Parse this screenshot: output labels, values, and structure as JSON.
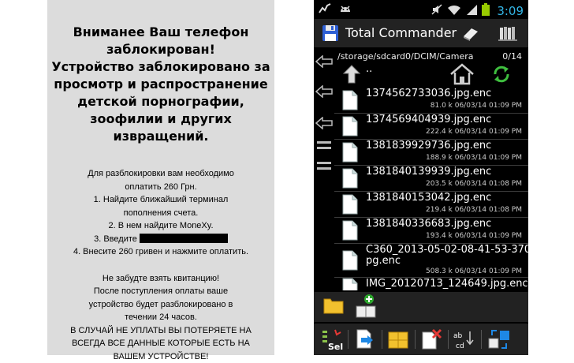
{
  "ransom": {
    "headline": [
      "Вниманее Ваш телефон",
      "заблокирован!",
      "Устройство заблокировано за",
      "просмотр и распространение",
      "детской порнографии,",
      "зоофилии и других",
      "извращений."
    ],
    "instructions": [
      "Для разблокировки вам необходимо",
      "оплатить 260 Грн.",
      "1. Найдите ближайший терминал",
      "пополнения счета.",
      "2. В нем найдите MoneXy."
    ],
    "step3_prefix": "3. Введите",
    "step4": "4. Внесите 260 гривен и нажмите оплатить.",
    "warning": [
      "Не забудте взять квитанцию!",
      "После поступления оплаты ваше",
      "устройство будет разблокировано в",
      "течении 24 часов.",
      "В СЛУЧАЙ НЕ УПЛАТЫ ВЫ ПОТЕРЯЕТЕ НА",
      "ВСЕГДА ВСЕ ДАННЫЕ КОТОРЫЕ ЕСТЬ НА",
      "ВАШЕМ УСТРОЙСТВЕ!"
    ]
  },
  "status_bar": {
    "time": "3:09"
  },
  "app": {
    "title": "Total Commander"
  },
  "browser": {
    "path": "/storage/sdcard0/DCIM/Camera",
    "count": "0/14",
    "parent": "..",
    "files": [
      {
        "name": "1374562733036.jpg.enc",
        "meta": "81.0 k  06/03/14  01:09 PM"
      },
      {
        "name": "1374569404939.jpg.enc",
        "meta": "222.4 k  06/03/14  01:09 PM"
      },
      {
        "name": "1381839929736.jpg.enc",
        "meta": "188.9 k  06/03/14  01:09 PM"
      },
      {
        "name": "1381840139939.jpg.enc",
        "meta": "203.5 k  06/03/14  01:08 PM"
      },
      {
        "name": "1381840153042.jpg.enc",
        "meta": "219.4 k  06/03/14  01:08 PM"
      },
      {
        "name": "1381840336683.jpg.enc",
        "meta": "193.4 k  06/03/14  01:09 PM"
      },
      {
        "name": "C360_2013-05-02-08-41-53-370.j",
        "name2": "pg.enc",
        "meta": "508.3 k  06/03/14  01:09 PM"
      },
      {
        "name": "IMG_20120713_124649.jpg.enc",
        "meta": ""
      }
    ]
  },
  "colors": {
    "accent": "#33b5e5",
    "battery": "#99cc00",
    "app_bar": "#222222",
    "ransom_bg": "#dcdcdc"
  }
}
